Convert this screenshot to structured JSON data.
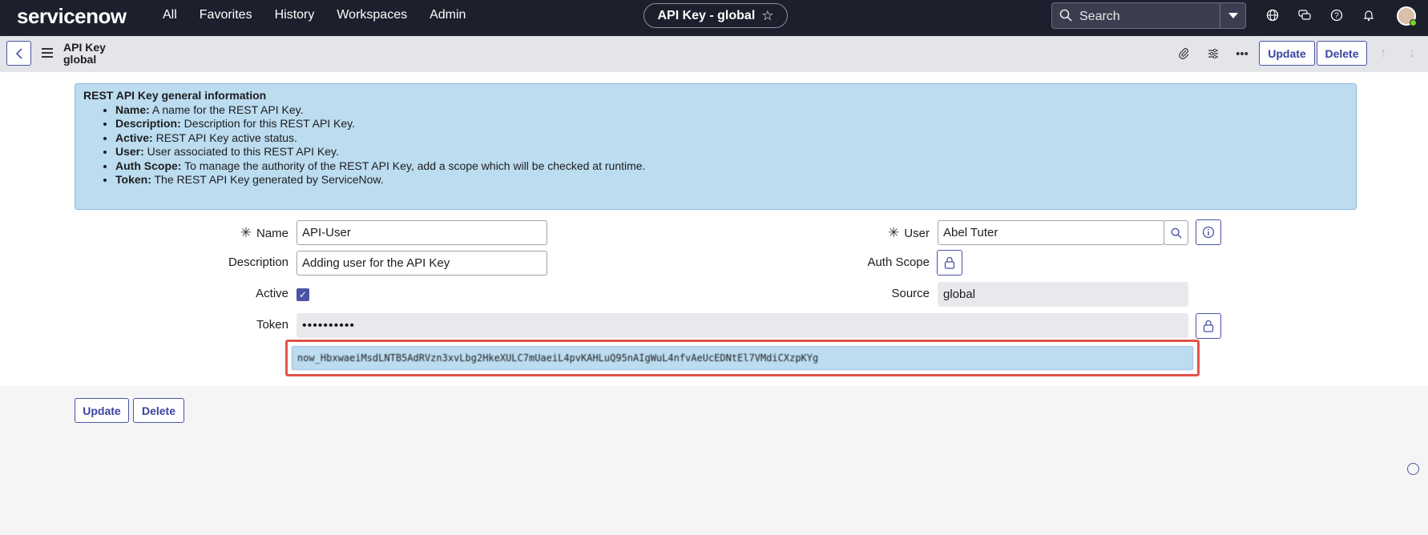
{
  "topnav": {
    "logo": "servicenow",
    "links": [
      "All",
      "Favorites",
      "History",
      "Workspaces",
      "Admin"
    ],
    "record_title": "API Key - global",
    "search_placeholder": "Search",
    "icons": [
      "globe-icon",
      "chat-icon",
      "help-icon",
      "bell-icon"
    ]
  },
  "header": {
    "title_line1": "API Key",
    "title_line2": "global",
    "update_label": "Update",
    "delete_label": "Delete"
  },
  "info": {
    "title": "REST API Key general information",
    "items": [
      {
        "term": "Name:",
        "desc": " A name for the REST API Key."
      },
      {
        "term": "Description:",
        "desc": " Description for this REST API Key."
      },
      {
        "term": "Active:",
        "desc": " REST API Key active status."
      },
      {
        "term": "User:",
        "desc": " User associated to this REST API Key."
      },
      {
        "term": "Auth Scope:",
        "desc": " To manage the authority of the REST API Key, add a scope which will be checked at runtime."
      },
      {
        "term": "Token:",
        "desc": " The REST API Key generated by ServiceNow."
      }
    ]
  },
  "form": {
    "name_label": "Name",
    "name_value": "API-User",
    "description_label": "Description",
    "description_value": "Adding user for the API Key",
    "active_label": "Active",
    "active_checked": true,
    "token_label": "Token",
    "token_masked": "••••••••••",
    "token_revealed": "now_HbxwaeiMsdLNTB5AdRVzn3xvLbg2HkeXULC7mUaeiL4pvKAHLuQ95nAIgWuL4nfvAeUcEDNtEl7VMdiCXzpKYg",
    "user_label": "User",
    "user_value": "Abel Tuter",
    "auth_scope_label": "Auth Scope",
    "source_label": "Source",
    "source_value": "global"
  },
  "footer": {
    "update_label": "Update",
    "delete_label": "Delete"
  },
  "colors": {
    "accent": "#4a53a6",
    "nav_bg": "#1c1f2c",
    "info_bg": "#bcdcf0",
    "highlight": "#e2534a"
  }
}
